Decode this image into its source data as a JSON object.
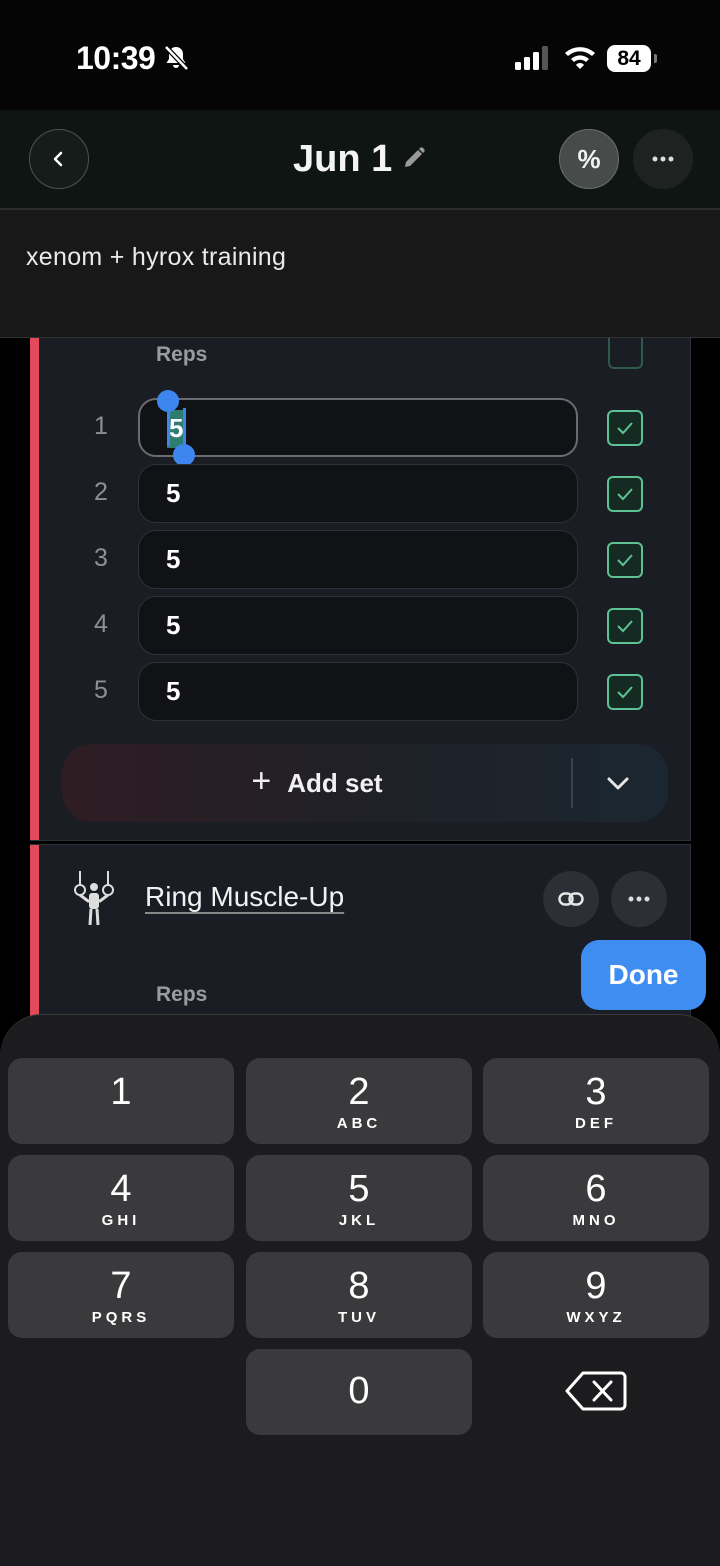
{
  "status_bar": {
    "time": "10:39",
    "battery": "84"
  },
  "header": {
    "title": "Jun 1",
    "percent_label": "%"
  },
  "notes": {
    "text": "xenom + hyrox training"
  },
  "exercise1": {
    "column_label": "Reps",
    "sets": [
      {
        "number": "1",
        "reps": "5",
        "done": true
      },
      {
        "number": "2",
        "reps": "5",
        "done": true
      },
      {
        "number": "3",
        "reps": "5",
        "done": true
      },
      {
        "number": "4",
        "reps": "5",
        "done": true
      },
      {
        "number": "5",
        "reps": "5",
        "done": true
      }
    ],
    "add_set_label": "Add set"
  },
  "exercise2": {
    "name": "Ring Muscle-Up",
    "column_label": "Reps"
  },
  "done_label": "Done",
  "keyboard": {
    "keys": [
      {
        "num": "1",
        "letters": ""
      },
      {
        "num": "2",
        "letters": "ABC"
      },
      {
        "num": "3",
        "letters": "DEF"
      },
      {
        "num": "4",
        "letters": "GHI"
      },
      {
        "num": "5",
        "letters": "JKL"
      },
      {
        "num": "6",
        "letters": "MNO"
      },
      {
        "num": "7",
        "letters": "PQRS"
      },
      {
        "num": "8",
        "letters": "TUV"
      },
      {
        "num": "9",
        "letters": "WXYZ"
      },
      {
        "num": "0",
        "letters": ""
      }
    ]
  },
  "colors": {
    "accent": "#e04a5a",
    "check": "#5cc294",
    "done_button": "#3f8df1"
  },
  "icons": [
    "bell-slash-icon",
    "signal-icon",
    "wifi-icon",
    "chevron-left-icon",
    "pencil-icon",
    "ellipsis-icon",
    "check-icon",
    "plus-icon",
    "chevron-down-icon",
    "gymnast-rings-icon",
    "link-icon",
    "delete-icon"
  ]
}
